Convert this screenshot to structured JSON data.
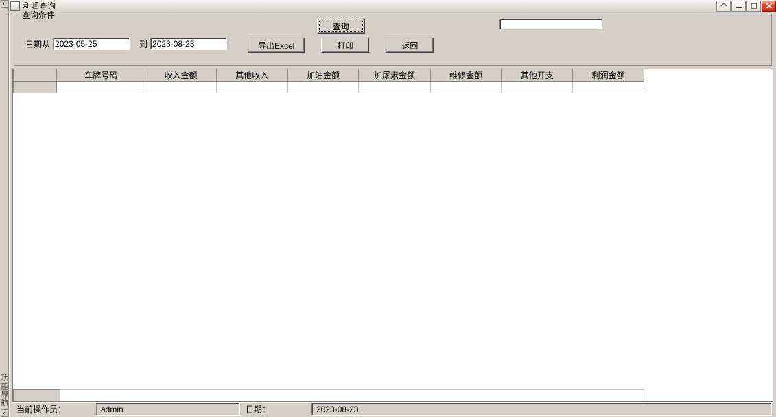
{
  "window": {
    "title": "利润查询"
  },
  "rail": {
    "expand": "»",
    "collapse": "»",
    "label": "功能导航"
  },
  "query_group": {
    "legend": "查询条件",
    "date_from_label": "日期从",
    "date_from": "2023-05-25",
    "date_to_label": "到",
    "date_to": "2023-08-23",
    "top_field": "",
    "buttons": {
      "query": "查询",
      "export": "导出Excel",
      "print": "打印",
      "back": "返回"
    }
  },
  "grid": {
    "columns": [
      "车牌号码",
      "收入金额",
      "其他收入",
      "加油金额",
      "加尿素金额",
      "维修金额",
      "其他开支",
      "利润金额"
    ],
    "rows": [
      {
        "cells": [
          "",
          "",
          "",
          "",
          "",
          "",
          "",
          ""
        ]
      }
    ]
  },
  "status": {
    "operator_label": "当前操作员：",
    "operator_value": "admin",
    "date_label": "日期：",
    "date_value": "2023-08-23"
  }
}
